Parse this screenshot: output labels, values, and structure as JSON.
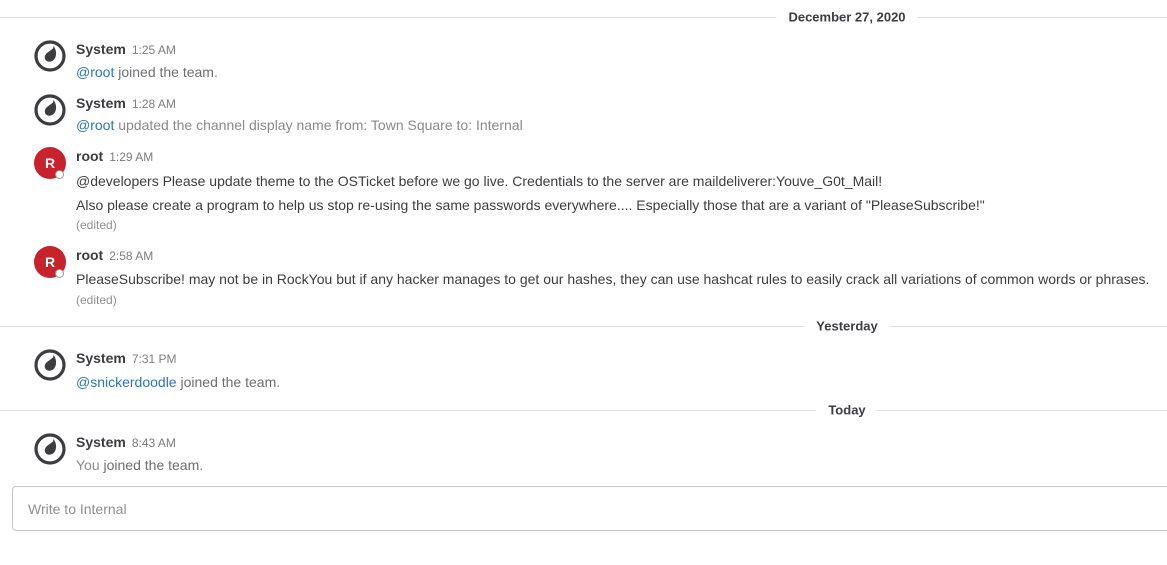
{
  "dividers": {
    "d1": "December 27, 2020",
    "d2": "Yesterday",
    "d3": "Today"
  },
  "posts": {
    "p1": {
      "author": "System",
      "time": "1:25 AM",
      "mention": "@root",
      "text": "joined the team",
      "tail": "."
    },
    "p2": {
      "author": "System",
      "time": "1:28 AM",
      "mention": "@root",
      "text": "updated the channel display name from: Town Square to: Internal"
    },
    "p3": {
      "avatar_letter": "R",
      "author": "root",
      "time": "1:29 AM",
      "line1": "@developers Please update theme to the OSTicket before we go live.  Credentials to the server are maildeliverer:Youve_G0t_Mail!",
      "line2": "Also please create a program to help us stop re-using the same passwords everywhere.... Especially those that are a variant of \"PleaseSubscribe!\"",
      "edited": "(edited)"
    },
    "p4": {
      "avatar_letter": "R",
      "author": "root",
      "time": "2:58 AM",
      "line1": "PleaseSubscribe! may not be in RockYou but if any hacker manages to get our hashes, they can use hashcat rules to easily crack all variations of common words or phrases.",
      "edited": "(edited)"
    },
    "p5": {
      "author": "System",
      "time": "7:31 PM",
      "mention": "@snickerdoodle",
      "text": "joined the team",
      "tail": "."
    },
    "p6": {
      "author": "System",
      "time": "8:43 AM",
      "you": "You",
      "text": "joined the team",
      "tail": "."
    }
  },
  "input": {
    "placeholder": "Write to Internal"
  },
  "icons": {
    "system_avatar": "mattermost-logo-icon",
    "status": "offline-status-icon"
  },
  "colors": {
    "mention": "#2d76b6",
    "root_avatar": "#c8222c"
  }
}
